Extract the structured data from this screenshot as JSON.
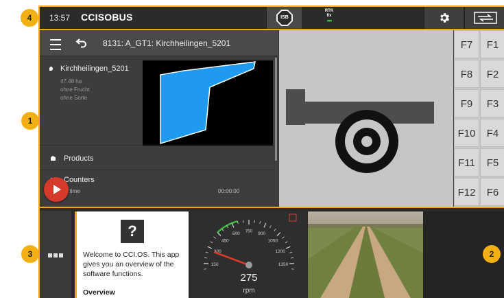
{
  "topbar": {
    "time": "13:57",
    "logo": "CCISOBUS",
    "isb_label": "ISB",
    "rtk_line1": "RTK",
    "rtk_line2": "fix",
    "rtk_dots": "•••",
    "settings_icon": "gear-icon",
    "swap_icon": "swap-arrows-icon"
  },
  "badges": [
    "1",
    "2",
    "3",
    "4"
  ],
  "left_panel": {
    "title": "8131: A_GT1: Kirchheilingen_5201",
    "field": {
      "name": "Kirchheilingen_5201",
      "area": "47.48 ha",
      "crop": "ohne Frucht",
      "variety": "ohne Sorte"
    },
    "products_label": "Products",
    "counters_label": "Counters",
    "counters_sub": "al time",
    "counters_value": "00:00:00"
  },
  "fkeys": {
    "left": [
      "F7",
      "F8",
      "F9",
      "F10",
      "F11",
      "F12"
    ],
    "right": [
      "F1",
      "F2",
      "F3",
      "F4",
      "F5",
      "F6"
    ]
  },
  "help": {
    "icon_text": "?",
    "text": "Welcome to CCI.OS. This app gives you an overview of the software functions.",
    "overview": "Overview"
  },
  "gauge": {
    "value": "275",
    "unit": "rpm",
    "tick_labels": [
      "0",
      "150",
      "300",
      "450",
      "600",
      "750",
      "900",
      "1050",
      "1200",
      "1350",
      "1500"
    ],
    "needle_value": 275,
    "max": 1500
  },
  "colors": {
    "accent": "#f2a900",
    "field_blue": "#1e9bf0",
    "play_red": "#d63a2a"
  }
}
